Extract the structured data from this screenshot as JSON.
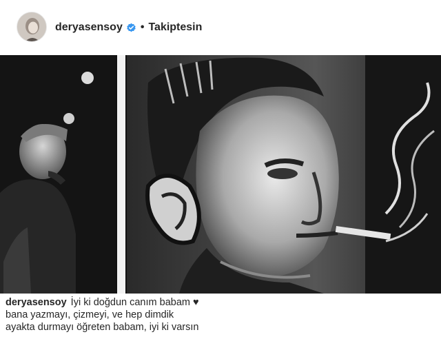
{
  "post": {
    "username": "deryasensoy",
    "verified": true,
    "separator": "•",
    "follow_status": "Takiptesin",
    "image_icon": "painting-artwork",
    "caption_lines": [
      "İyi ki doğdun canım babam",
      "bana yazmayı, çizmeyi, ve hep dimdik",
      "ayakta durmayı öğreten babam, iyi ki varsın"
    ],
    "caption_emoji": "♥"
  },
  "colors": {
    "verified_blue": "#3897f0",
    "text": "#262626"
  }
}
